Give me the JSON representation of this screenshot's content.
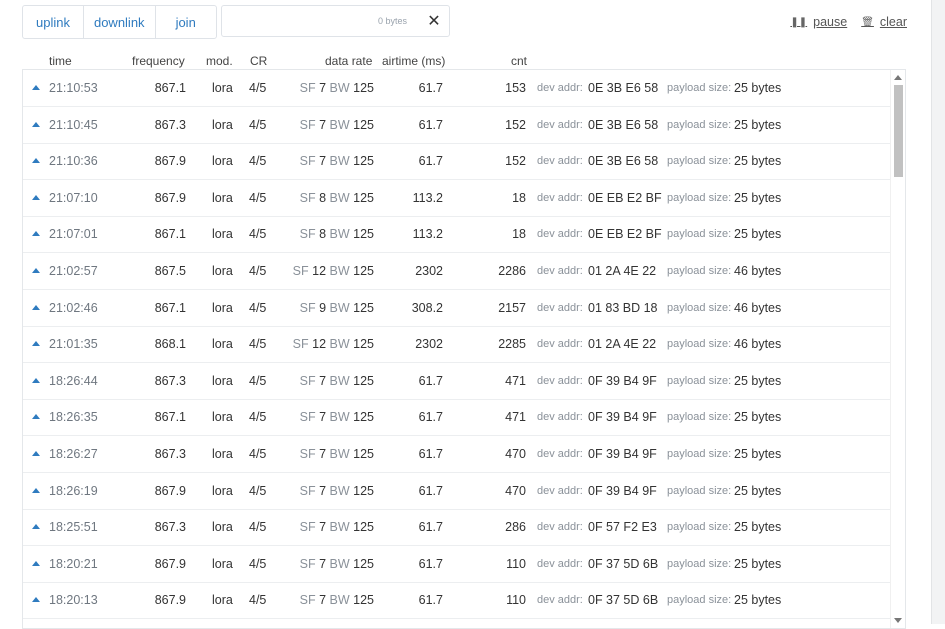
{
  "filters": {
    "uplink": "uplink",
    "downlink": "downlink",
    "join": "join"
  },
  "filter_box": {
    "counter": "0 bytes",
    "clear_symbol": "✕"
  },
  "controls": {
    "pause_label": "pause",
    "clear_label": "clear"
  },
  "columns": {
    "time": "time",
    "frequency": "frequency",
    "mod": "mod.",
    "cr": "CR",
    "data_rate": "data rate",
    "airtime": "airtime (ms)",
    "cnt": "cnt"
  },
  "labels": {
    "sf": "SF",
    "bw": "BW",
    "dev_addr": "dev addr:",
    "payload_size": "payload size:"
  },
  "rows": [
    {
      "time": "21:10:53",
      "freq": "867.1",
      "mod": "lora",
      "cr": "4/5",
      "sf": "7",
      "bw": "125",
      "air": "61.7",
      "cnt": "153",
      "addr": "0E 3B E6 58",
      "payload": "25 bytes"
    },
    {
      "time": "21:10:45",
      "freq": "867.3",
      "mod": "lora",
      "cr": "4/5",
      "sf": "7",
      "bw": "125",
      "air": "61.7",
      "cnt": "152",
      "addr": "0E 3B E6 58",
      "payload": "25 bytes"
    },
    {
      "time": "21:10:36",
      "freq": "867.9",
      "mod": "lora",
      "cr": "4/5",
      "sf": "7",
      "bw": "125",
      "air": "61.7",
      "cnt": "152",
      "addr": "0E 3B E6 58",
      "payload": "25 bytes"
    },
    {
      "time": "21:07:10",
      "freq": "867.9",
      "mod": "lora",
      "cr": "4/5",
      "sf": "8",
      "bw": "125",
      "air": "113.2",
      "cnt": "18",
      "addr": "0E EB E2 BF",
      "payload": "25 bytes"
    },
    {
      "time": "21:07:01",
      "freq": "867.1",
      "mod": "lora",
      "cr": "4/5",
      "sf": "8",
      "bw": "125",
      "air": "113.2",
      "cnt": "18",
      "addr": "0E EB E2 BF",
      "payload": "25 bytes"
    },
    {
      "time": "21:02:57",
      "freq": "867.5",
      "mod": "lora",
      "cr": "4/5",
      "sf": "12",
      "bw": "125",
      "air": "2302",
      "cnt": "2286",
      "addr": "01 2A 4E 22",
      "payload": "46 bytes"
    },
    {
      "time": "21:02:46",
      "freq": "867.1",
      "mod": "lora",
      "cr": "4/5",
      "sf": "9",
      "bw": "125",
      "air": "308.2",
      "cnt": "2157",
      "addr": "01 83 BD 18",
      "payload": "46 bytes"
    },
    {
      "time": "21:01:35",
      "freq": "868.1",
      "mod": "lora",
      "cr": "4/5",
      "sf": "12",
      "bw": "125",
      "air": "2302",
      "cnt": "2285",
      "addr": "01 2A 4E 22",
      "payload": "46 bytes"
    },
    {
      "time": "18:26:44",
      "freq": "867.3",
      "mod": "lora",
      "cr": "4/5",
      "sf": "7",
      "bw": "125",
      "air": "61.7",
      "cnt": "471",
      "addr": "0F 39 B4 9F",
      "payload": "25 bytes"
    },
    {
      "time": "18:26:35",
      "freq": "867.1",
      "mod": "lora",
      "cr": "4/5",
      "sf": "7",
      "bw": "125",
      "air": "61.7",
      "cnt": "471",
      "addr": "0F 39 B4 9F",
      "payload": "25 bytes"
    },
    {
      "time": "18:26:27",
      "freq": "867.3",
      "mod": "lora",
      "cr": "4/5",
      "sf": "7",
      "bw": "125",
      "air": "61.7",
      "cnt": "470",
      "addr": "0F 39 B4 9F",
      "payload": "25 bytes"
    },
    {
      "time": "18:26:19",
      "freq": "867.9",
      "mod": "lora",
      "cr": "4/5",
      "sf": "7",
      "bw": "125",
      "air": "61.7",
      "cnt": "470",
      "addr": "0F 39 B4 9F",
      "payload": "25 bytes"
    },
    {
      "time": "18:25:51",
      "freq": "867.3",
      "mod": "lora",
      "cr": "4/5",
      "sf": "7",
      "bw": "125",
      "air": "61.7",
      "cnt": "286",
      "addr": "0F 57 F2 E3",
      "payload": "25 bytes"
    },
    {
      "time": "18:20:21",
      "freq": "867.9",
      "mod": "lora",
      "cr": "4/5",
      "sf": "7",
      "bw": "125",
      "air": "61.7",
      "cnt": "110",
      "addr": "0F 37 5D 6B",
      "payload": "25 bytes"
    },
    {
      "time": "18:20:13",
      "freq": "867.9",
      "mod": "lora",
      "cr": "4/5",
      "sf": "7",
      "bw": "125",
      "air": "61.7",
      "cnt": "110",
      "addr": "0F 37 5D 6B",
      "payload": "25 bytes"
    }
  ]
}
